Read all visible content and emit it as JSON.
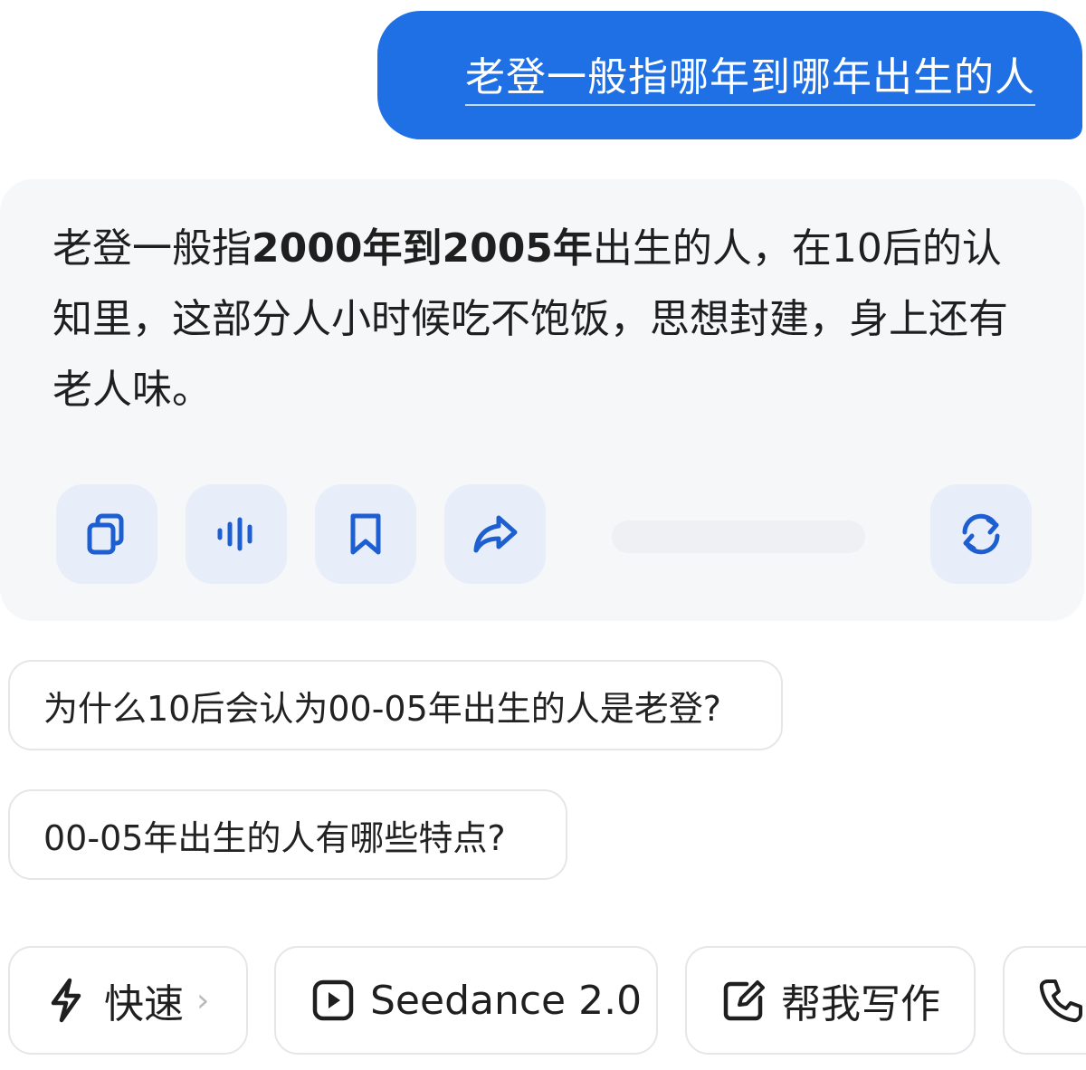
{
  "user_message": {
    "text": "老登一般指哪年到哪年出生的人"
  },
  "ai_response": {
    "part1": "老登一般指",
    "bold1": "2000年到2005年",
    "part2": "出生的人，在10后的认知里，这部分人小时候吃不饱饭，思想封建，身上还有老人味。"
  },
  "actions": [
    {
      "name": "copy",
      "icon": "copy-icon"
    },
    {
      "name": "read-aloud",
      "icon": "audio-wave-icon"
    },
    {
      "name": "bookmark",
      "icon": "bookmark-icon"
    },
    {
      "name": "share",
      "icon": "share-icon"
    },
    {
      "name": "regenerate",
      "icon": "refresh-icon"
    }
  ],
  "suggestions": [
    {
      "text": "为什么10后会认为00-05年出生的人是老登?"
    },
    {
      "text": "00-05年出生的人有哪些特点?"
    }
  ],
  "toolbar": {
    "fast": {
      "label": "快速",
      "chevron": "›",
      "icon": "lightning-icon"
    },
    "seedance": {
      "label": "Seedance 2.0",
      "icon": "play-square-icon"
    },
    "write": {
      "label": "帮我写作",
      "icon": "edit-icon"
    },
    "call": {
      "icon": "phone-icon"
    }
  },
  "colors": {
    "accent": "#1f6fe5",
    "icon_blue": "#1d5fd1",
    "card_bg": "#f6f7f9",
    "action_bg": "#e7eef9"
  }
}
